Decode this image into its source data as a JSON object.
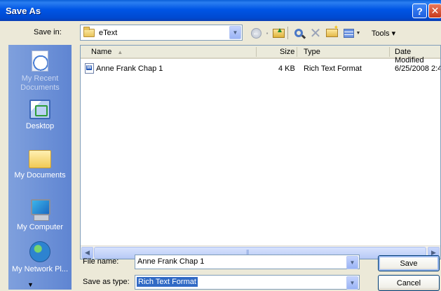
{
  "window": {
    "title": "Save As",
    "help_glyph": "?",
    "close_glyph": "✕"
  },
  "save_in": {
    "label": "Save in:",
    "value": "eText"
  },
  "toolbar": {
    "delete_glyph": "✕",
    "tools_label": "Tools ▾"
  },
  "places": [
    {
      "id": "recent",
      "label": "My Recent Documents",
      "icon": "recent-documents-icon"
    },
    {
      "id": "desktop",
      "label": "Desktop",
      "icon": "desktop-icon"
    },
    {
      "id": "documents",
      "label": "My Documents",
      "icon": "my-documents-icon"
    },
    {
      "id": "computer",
      "label": "My Computer",
      "icon": "my-computer-icon"
    },
    {
      "id": "network",
      "label": "My Network Pl...",
      "icon": "my-network-icon"
    }
  ],
  "list": {
    "columns": [
      "Name",
      "Size",
      "Type",
      "Date Modified"
    ],
    "sort_glyph": "▲",
    "rows": [
      {
        "name": "Anne Frank Chap 1",
        "size": "4 KB",
        "type": "Rich Text Format",
        "modified": "6/25/2008 2:4"
      }
    ]
  },
  "file_name": {
    "label": "File name:",
    "value": "Anne Frank Chap 1"
  },
  "file_type": {
    "label": "Save as type:",
    "value": "Rich Text Format"
  },
  "buttons": {
    "save": "Save",
    "cancel": "Cancel"
  },
  "more_glyph": "▼",
  "dropdown_glyph": "▼",
  "scroll": {
    "left": "◀",
    "right": "▶"
  }
}
